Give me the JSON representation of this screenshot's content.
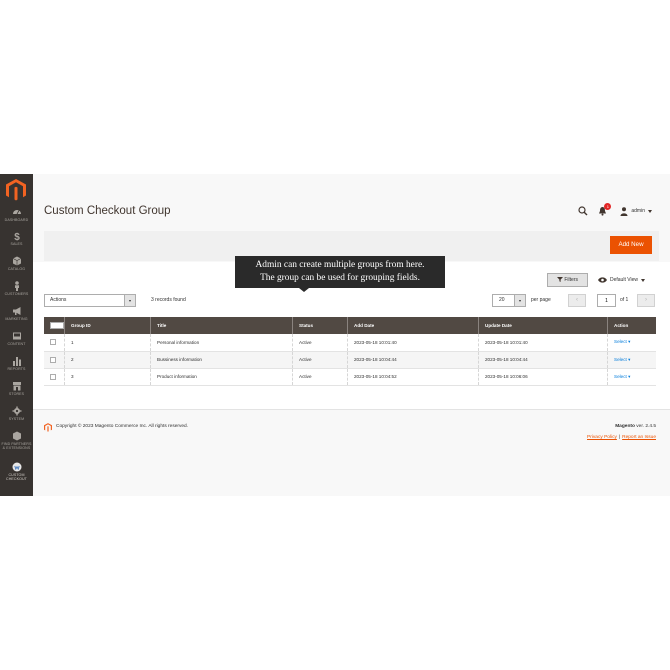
{
  "sidebar": {
    "items": [
      {
        "label": "Dashboard",
        "icon": "dashboard-icon"
      },
      {
        "label": "Sales",
        "icon": "dollar-icon"
      },
      {
        "label": "Catalog",
        "icon": "cube-icon"
      },
      {
        "label": "Customers",
        "icon": "person-icon"
      },
      {
        "label": "Marketing",
        "icon": "megaphone-icon"
      },
      {
        "label": "Content",
        "icon": "content-icon"
      },
      {
        "label": "Reports",
        "icon": "bar-chart-icon"
      },
      {
        "label": "Stores",
        "icon": "store-icon"
      },
      {
        "label": "System",
        "icon": "gear-icon"
      },
      {
        "label": "Find Partners & Extensions",
        "icon": "box-icon"
      },
      {
        "label": "Custom Checkout",
        "icon": "checkout-icon"
      }
    ]
  },
  "header": {
    "title": "Custom Checkout Group",
    "notifications_count": "1",
    "user_name": "admin"
  },
  "toolbar": {
    "add_new_label": "Add New",
    "filters_label": "Filters",
    "view_label": "Default View"
  },
  "tooltip": {
    "line1": "Admin can create multiple groups from here.",
    "line2": "The group can be used for grouping fields."
  },
  "grid_controls": {
    "actions_label": "Actions",
    "records_found": "3 records found",
    "per_page_value": "20",
    "per_page_label": "per page",
    "page_value": "1",
    "page_of": "of 1"
  },
  "table": {
    "headers": [
      "Group ID",
      "Title",
      "Status",
      "Add Date",
      "Update Date",
      "Action"
    ],
    "rows": [
      {
        "id": "1",
        "title": "Personal information",
        "status": "Active",
        "add_date": "2023-05-18 10:01:40",
        "update_date": "2023-05-18 10:01:40",
        "action": "Select"
      },
      {
        "id": "2",
        "title": "Bussiness information",
        "status": "Active",
        "add_date": "2023-05-18 10:04:44",
        "update_date": "2023-05-18 10:04:44",
        "action": "Select"
      },
      {
        "id": "3",
        "title": "Product information",
        "status": "Active",
        "add_date": "2023-05-18 10:04:52",
        "update_date": "2023-05-18 10:06:06",
        "action": "Select"
      }
    ]
  },
  "footer": {
    "copyright": "Copyright © 2023 Magento Commerce Inc. All rights reserved.",
    "brand": "Magento",
    "version": "ver. 2.4.5",
    "privacy_link": "Privacy Policy",
    "separator": "|",
    "report_link": "Report an Issue"
  },
  "colors": {
    "accent": "#eb5202",
    "sidebar_bg": "#373330",
    "table_header_bg": "#514943",
    "link": "#007bdb"
  }
}
